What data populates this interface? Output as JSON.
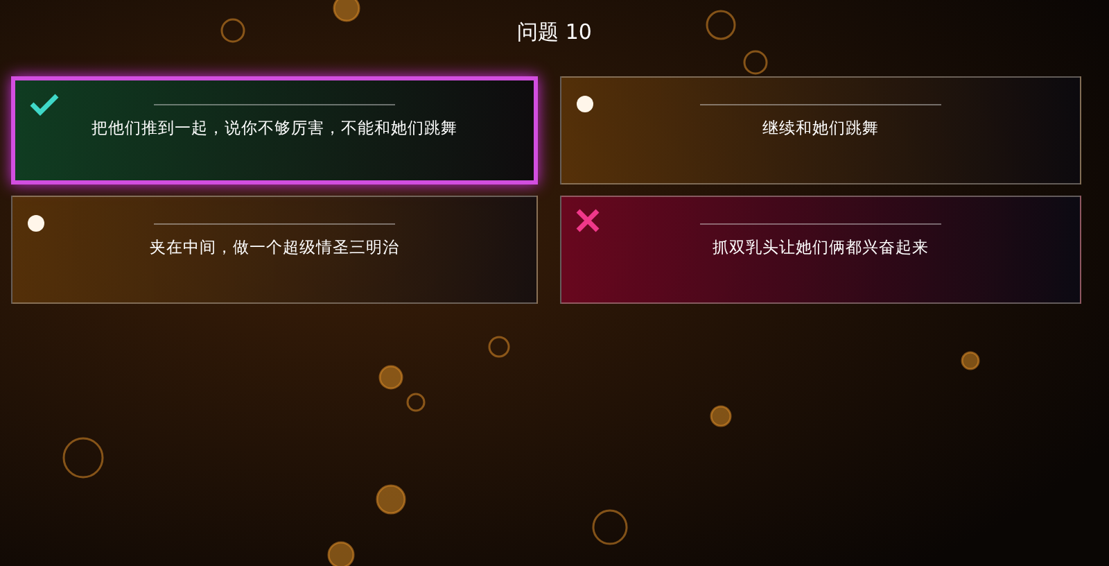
{
  "title": "问题 10",
  "options": [
    {
      "text": "把他们推到一起，说你不够厉害，不能和她们跳舞",
      "kind": "correct",
      "selected": true
    },
    {
      "text": "继续和她们跳舞",
      "kind": "neutral",
      "selected": false
    },
    {
      "text": "夹在中间，做一个超级情圣三明治",
      "kind": "neutral",
      "selected": false
    },
    {
      "text": "抓双乳头让她们俩都兴奋起来",
      "kind": "wrong",
      "selected": false
    }
  ]
}
